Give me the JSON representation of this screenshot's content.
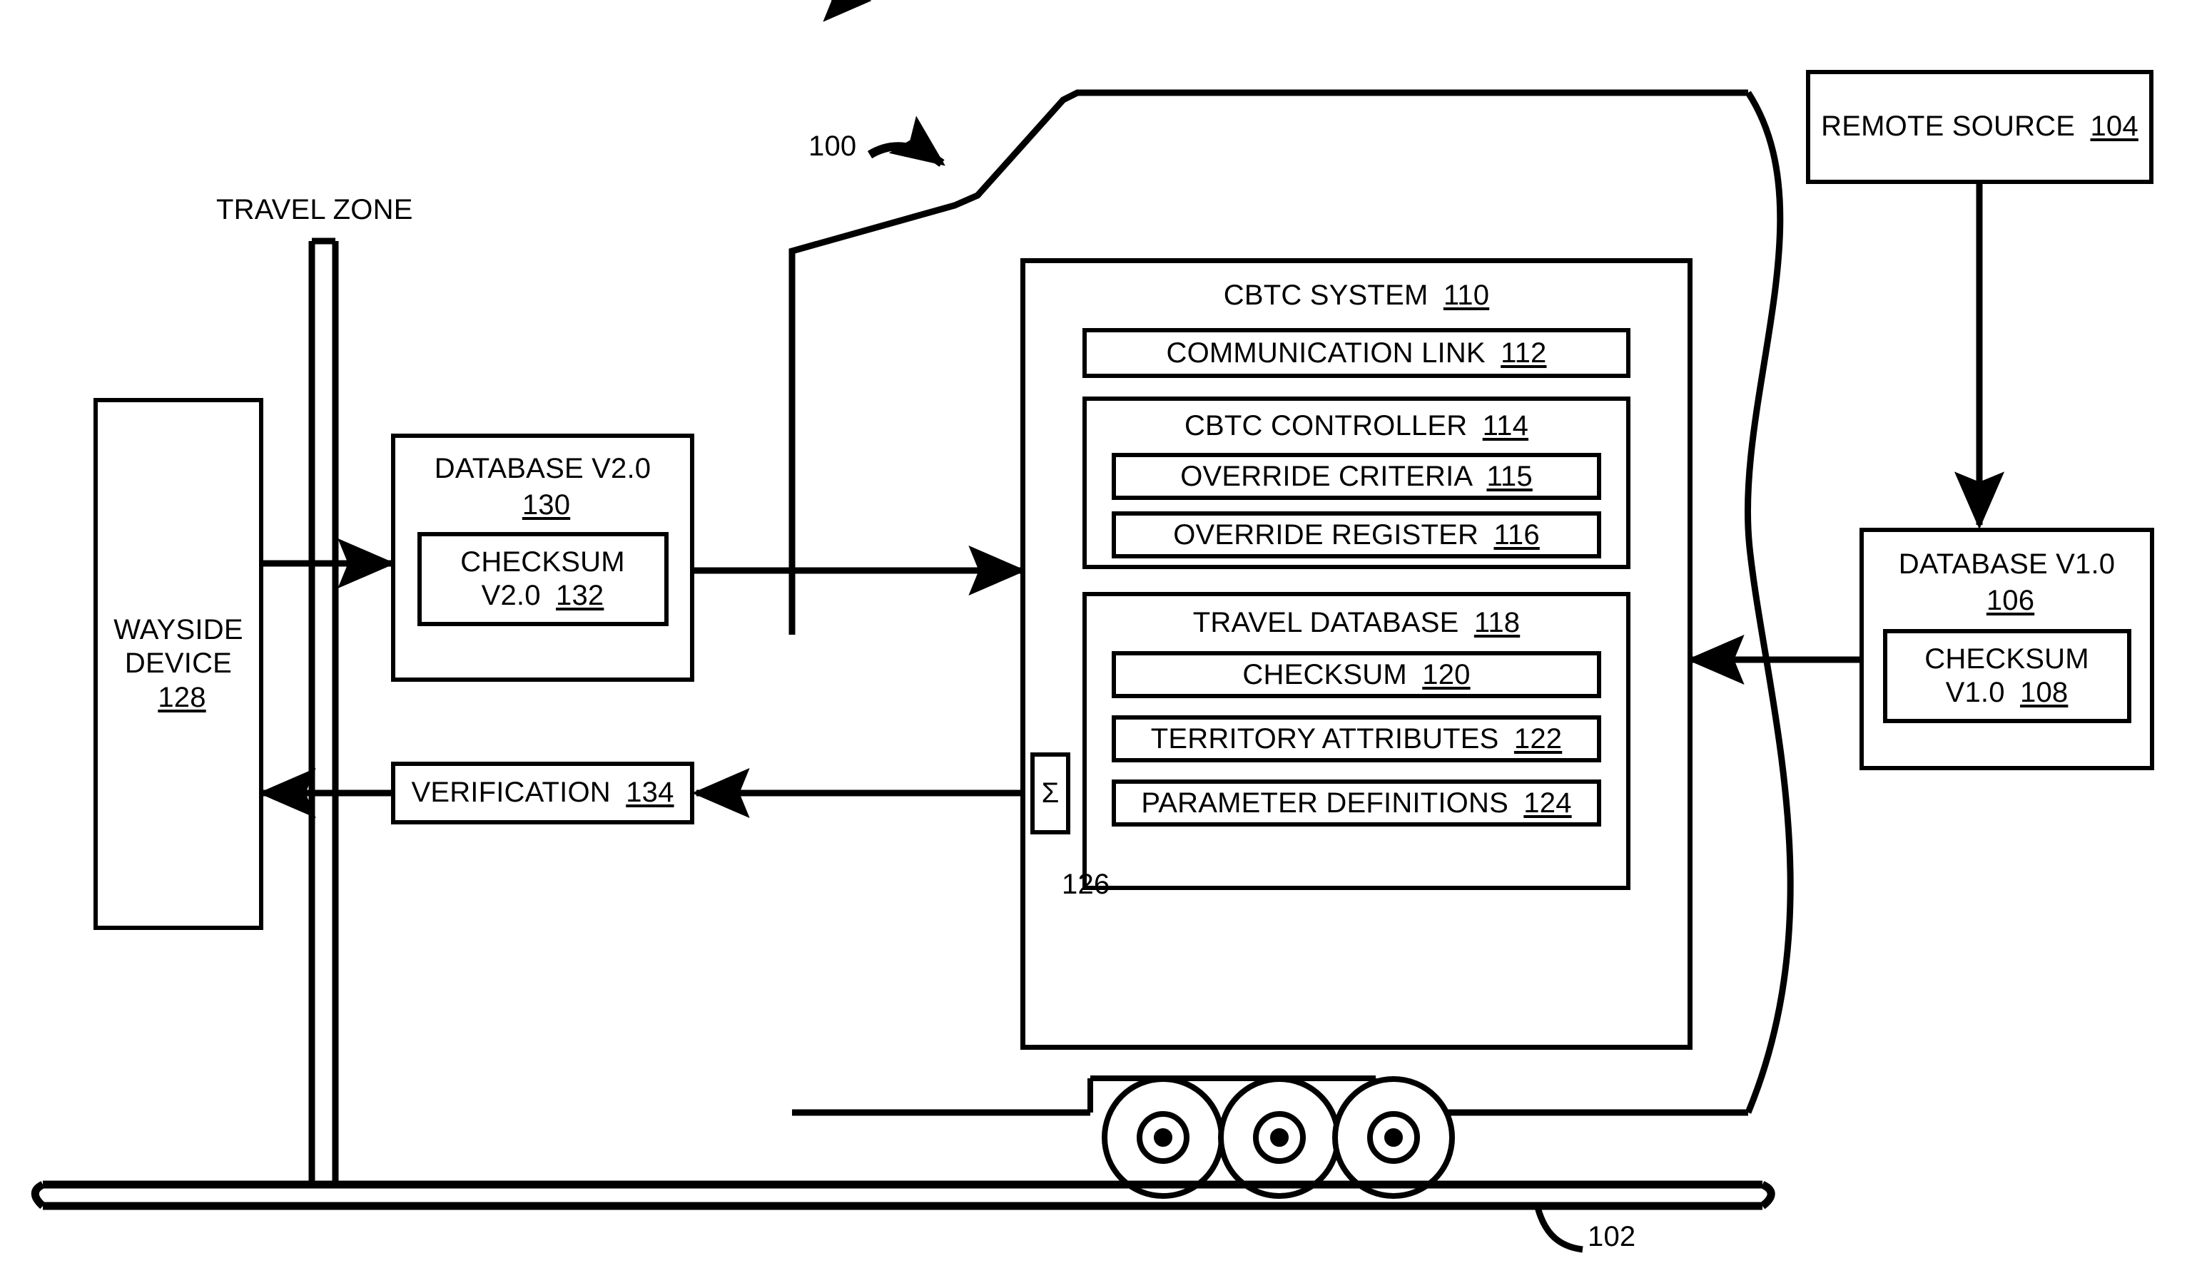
{
  "figure": {
    "figure_ref": "100",
    "track_ref": "102",
    "travel_zone_label": "TRAVEL ZONE",
    "sigma_symbol": "Σ",
    "sigma_ref": "126"
  },
  "remote_source": {
    "label": "REMOTE SOURCE",
    "ref": "104"
  },
  "database_v1": {
    "label": "DATABASE V1.0",
    "ref": "106",
    "checksum": {
      "line1": "CHECKSUM",
      "line2": "V1.0",
      "ref": "108"
    }
  },
  "wayside_device": {
    "line1": "WAYSIDE",
    "line2": "DEVICE",
    "ref": "128"
  },
  "database_v2": {
    "label": "DATABASE V2.0",
    "ref": "130",
    "checksum": {
      "line1": "CHECKSUM",
      "line2": "V2.0",
      "ref": "132"
    }
  },
  "verification": {
    "label": "VERIFICATION",
    "ref": "134"
  },
  "cbtc_system": {
    "label": "CBTC SYSTEM",
    "ref": "110",
    "communication_link": {
      "label": "COMMUNICATION LINK",
      "ref": "112"
    },
    "controller": {
      "label": "CBTC CONTROLLER",
      "ref": "114",
      "items": [
        {
          "label": "OVERRIDE CRITERIA",
          "ref": "115"
        },
        {
          "label": "OVERRIDE REGISTER",
          "ref": "116"
        }
      ]
    },
    "travel_database": {
      "label": "TRAVEL DATABASE",
      "ref": "118",
      "items": [
        {
          "label": "CHECKSUM",
          "ref": "120"
        },
        {
          "label": "TERRITORY ATTRIBUTES",
          "ref": "122"
        },
        {
          "label": "PARAMETER DEFINITIONS",
          "ref": "124"
        }
      ]
    }
  },
  "colors": {
    "line": "#000000",
    "background": "#ffffff"
  }
}
